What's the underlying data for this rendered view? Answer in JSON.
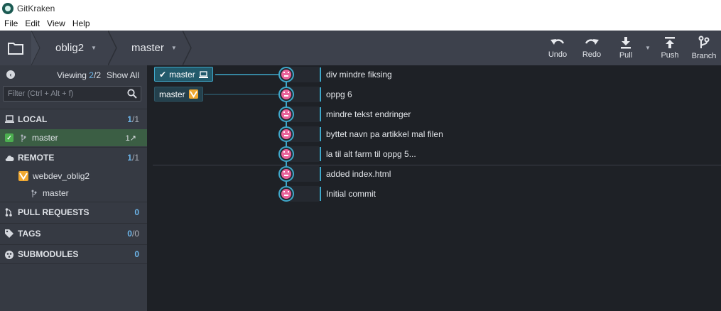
{
  "app": {
    "title": "GitKraken"
  },
  "menu": [
    "File",
    "Edit",
    "View",
    "Help"
  ],
  "toolbar": {
    "repo": "oblig2",
    "branch": "master",
    "actions": [
      {
        "label": "Undo",
        "icon": "undo-icon"
      },
      {
        "label": "Redo",
        "icon": "redo-icon"
      },
      {
        "label": "Pull",
        "icon": "pull-icon"
      },
      {
        "label": "Push",
        "icon": "push-icon"
      },
      {
        "label": "Branch",
        "icon": "branch-icon"
      }
    ]
  },
  "sidebar": {
    "viewing_label": "Viewing",
    "viewing_count": "2",
    "viewing_total": "/2",
    "show_all": "Show All",
    "filter_placeholder": "Filter (Ctrl + Alt + f)",
    "sections": {
      "local": {
        "title": "LOCAL",
        "count": "1",
        "total": "/1"
      },
      "remote": {
        "title": "REMOTE",
        "count": "1",
        "total": "/1"
      },
      "pull_requests": {
        "title": "PULL REQUESTS",
        "count": "0"
      },
      "tags": {
        "title": "TAGS",
        "count": "0",
        "total": "/0"
      },
      "submodules": {
        "title": "SUBMODULES",
        "count": "0"
      }
    },
    "local_branches": [
      {
        "name": "master",
        "status": "1↗"
      }
    ],
    "remote_name": "webdev_oblig2",
    "remote_branches": [
      {
        "name": "master"
      }
    ]
  },
  "graph": {
    "tags": [
      {
        "label": "master",
        "kind": "local"
      },
      {
        "label": "master",
        "kind": "remote"
      }
    ],
    "commits": [
      "div mindre fiksing",
      "oppg 6",
      "mindre tekst endringer",
      "byttet navn pa artikkel mal filen",
      "la til alt farm til oppg 5...",
      "added index.html",
      "Initial commit"
    ]
  },
  "colors": {
    "accent": "#3fa7c9",
    "avatar": "#e9639b",
    "active_branch": "#3b5e44",
    "count": "#6cb4e8"
  }
}
